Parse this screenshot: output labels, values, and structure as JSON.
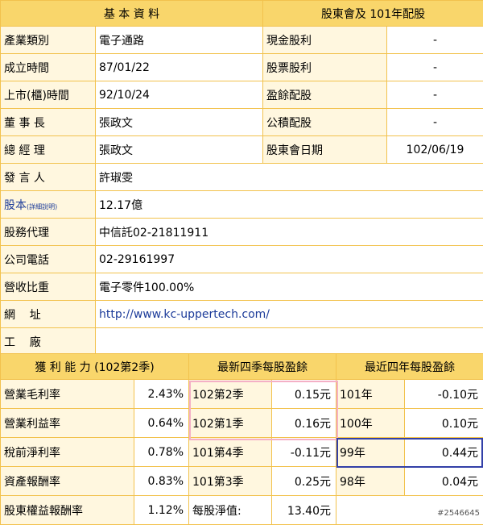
{
  "basic": {
    "header": "基 本 資 料",
    "rows": [
      {
        "label": "產業類別",
        "value": "電子通路"
      },
      {
        "label": "成立時間",
        "value": "87/01/22"
      },
      {
        "label": "上市(櫃)時間",
        "value": "92/10/24"
      },
      {
        "label": "董 事 長",
        "value": "張政文"
      },
      {
        "label": "總 經 理",
        "value": "張政文"
      },
      {
        "label": "發 言 人",
        "value": "許琡雯"
      },
      {
        "label": "股本",
        "label_small": "(詳細說明)",
        "value": "12.17億"
      },
      {
        "label": "股務代理",
        "value": "中信託02-21811911"
      },
      {
        "label": "公司電話",
        "value": "02-29161997"
      },
      {
        "label": "營收比重",
        "value": "電子零件100.00%"
      },
      {
        "label": "網    址",
        "value": "http://www.kc-uppertech.com/"
      },
      {
        "label": "工    廠",
        "value": ""
      }
    ]
  },
  "dividend": {
    "header": "股東會及 101年配股",
    "rows": [
      {
        "label": "現金股利",
        "value": "-"
      },
      {
        "label": "股票股利",
        "value": "-"
      },
      {
        "label": "盈餘配股",
        "value": "-"
      },
      {
        "label": "公積配股",
        "value": "-"
      },
      {
        "label": "股東會日期",
        "value": "102/06/19"
      }
    ]
  },
  "bottom": {
    "headers": [
      "獲 利 能 力 (102第2季)",
      "最新四季每股盈餘",
      "最近四年每股盈餘"
    ],
    "rows": [
      {
        "profit_label": "營業毛利率",
        "profit_value": "2.43%",
        "q_label": "102第2季",
        "q_value": "0.15元",
        "y_label": "101年",
        "y_value": "-0.10元"
      },
      {
        "profit_label": "營業利益率",
        "profit_value": "0.64%",
        "q_label": "102第1季",
        "q_value": "0.16元",
        "y_label": "100年",
        "y_value": "0.10元"
      },
      {
        "profit_label": "稅前淨利率",
        "profit_value": "0.78%",
        "q_label": "101第4季",
        "q_value": "-0.11元",
        "y_label": "99年",
        "y_value": "0.44元"
      },
      {
        "profit_label": "資產報酬率",
        "profit_value": "0.83%",
        "q_label": "101第3季",
        "q_value": "0.25元",
        "y_label": "98年",
        "y_value": "0.04元"
      },
      {
        "profit_label": "股東權益報酬率",
        "profit_value": "1.12%",
        "nav_label": "每股淨值:",
        "nav_value": "13.40元"
      }
    ]
  },
  "stamp": "#2546645",
  "colors": {
    "border": "#f2c24d",
    "header_bg": "#f9d66b",
    "label_bg": "#fff7df",
    "link": "#1d3c9a",
    "pink_box": "#f4b0c6",
    "blue_box": "#3340a8"
  }
}
